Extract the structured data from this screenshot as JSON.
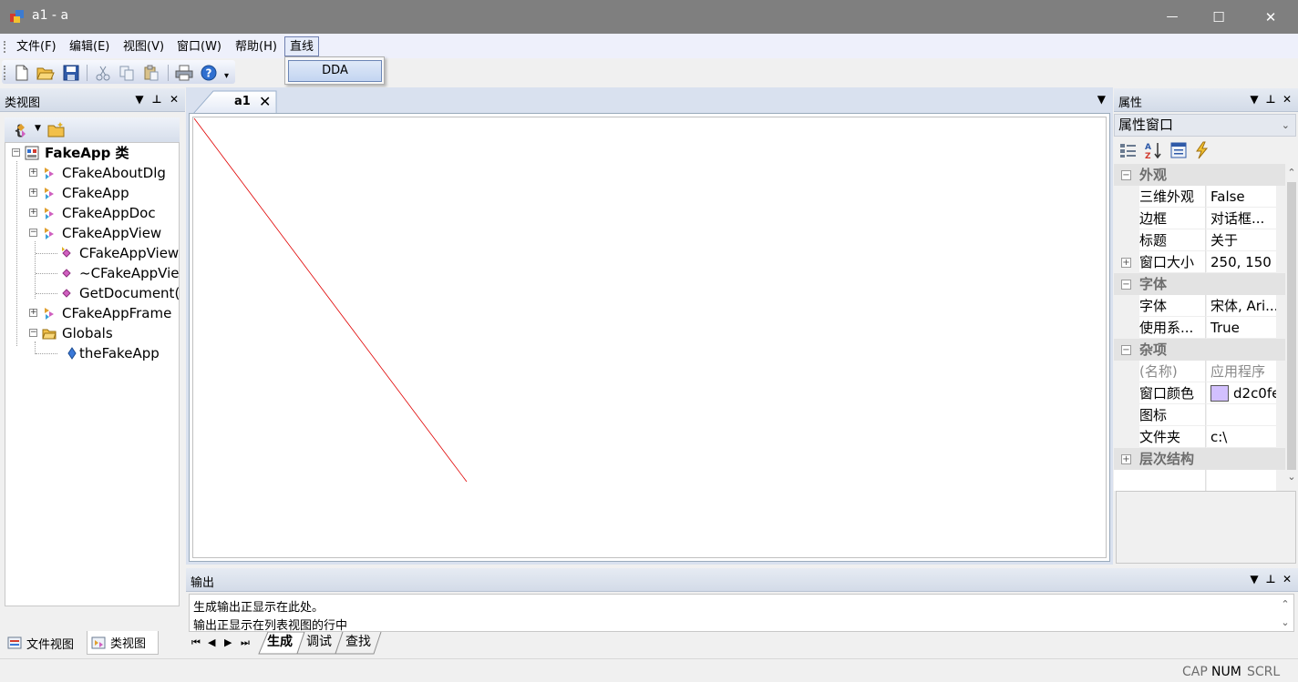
{
  "window": {
    "title": "a1 - a",
    "minimize_glyph": "—",
    "maximize_glyph": "☐",
    "close_glyph": "✕"
  },
  "menu": {
    "items": [
      "文件(F)",
      "编辑(E)",
      "视图(V)",
      "窗口(W)",
      "帮助(H)",
      "直线"
    ],
    "open_menu": {
      "label": "直线",
      "items": [
        "DDA"
      ]
    }
  },
  "toolbar": {
    "buttons": [
      "new-icon",
      "open-icon",
      "save-icon",
      "cut-icon",
      "copy-icon",
      "paste-icon",
      "print-icon",
      "help-icon"
    ],
    "overflow_glyph": "▾"
  },
  "class_view": {
    "title": "类视图",
    "header_buttons": {
      "dropdown": "▼",
      "pin": "⊥",
      "close": "✕"
    },
    "tree": [
      {
        "label": "FakeApp 类",
        "level": 0,
        "expander": "−",
        "icon": "class-root-icon",
        "bold": true
      },
      {
        "label": "CFakeAboutDlg",
        "level": 1,
        "expander": "+",
        "icon": "class-icon"
      },
      {
        "label": "CFakeApp",
        "level": 1,
        "expander": "+",
        "icon": "class-icon"
      },
      {
        "label": "CFakeAppDoc",
        "level": 1,
        "expander": "+",
        "icon": "class-icon"
      },
      {
        "label": "CFakeAppView",
        "level": 1,
        "expander": "−",
        "icon": "class-icon"
      },
      {
        "label": "CFakeAppView",
        "level": 2,
        "expander": "",
        "icon": "method-icon"
      },
      {
        "label": "~CFakeAppView",
        "level": 2,
        "expander": "",
        "icon": "method-icon"
      },
      {
        "label": "GetDocument()",
        "level": 2,
        "expander": "",
        "icon": "method-icon"
      },
      {
        "label": "CFakeAppFrame",
        "level": 1,
        "expander": "+",
        "icon": "class-icon"
      },
      {
        "label": "Globals",
        "level": 1,
        "expander": "−",
        "icon": "folder-icon"
      },
      {
        "label": "theFakeApp",
        "level": 2,
        "expander": "",
        "icon": "variable-icon"
      }
    ],
    "bottom_tabs": [
      {
        "label": "文件视图",
        "icon": "file-view-icon",
        "active": false
      },
      {
        "label": "类视图",
        "icon": "class-view-icon",
        "active": true
      }
    ]
  },
  "document": {
    "tab_label": "a1",
    "tab_close": "✕",
    "dropdown_glyph": "▼",
    "line_color": "#e00000"
  },
  "properties": {
    "title": "属性",
    "header_buttons": {
      "dropdown": "▼",
      "pin": "⊥",
      "close": "✕"
    },
    "combo_value": "属性窗口",
    "combo_chevron": "⌄",
    "toolbar": [
      "categorized-icon",
      "alphabetical-icon",
      "property-pages-icon",
      "events-icon"
    ],
    "rows": [
      {
        "type": "category",
        "name": "外观",
        "expander": "−"
      },
      {
        "type": "prop",
        "name": "三维外观",
        "value": "False"
      },
      {
        "type": "prop",
        "name": "边框",
        "value": "对话框..."
      },
      {
        "type": "prop",
        "name": "标题",
        "value": "关于"
      },
      {
        "type": "prop",
        "name": "窗口大小",
        "value": "250, 150",
        "expander": "+"
      },
      {
        "type": "category",
        "name": "字体",
        "expander": "−"
      },
      {
        "type": "prop",
        "name": "字体",
        "value": "宋体, Ari..."
      },
      {
        "type": "prop",
        "name": "使用系...",
        "value": "True"
      },
      {
        "type": "category",
        "name": "杂项",
        "expander": "−"
      },
      {
        "type": "prop",
        "name": "(名称)",
        "value": "应用程序",
        "gray": true
      },
      {
        "type": "prop",
        "name": "窗口颜色",
        "value": "d2c0fe",
        "swatch": "#d2c0fe"
      },
      {
        "type": "prop",
        "name": "图标",
        "value": ""
      },
      {
        "type": "prop",
        "name": "文件夹",
        "value": "c:\\"
      },
      {
        "type": "category",
        "name": "层次结构",
        "expander": "+"
      }
    ]
  },
  "output": {
    "title": "输出",
    "header_buttons": {
      "dropdown": "▼",
      "pin": "⊥",
      "close": "✕"
    },
    "lines": [
      "生成输出正显示在此处。",
      "输出正显示在列表视图的行中"
    ],
    "nav": [
      "⏮",
      "◀",
      "▶",
      "⏭"
    ],
    "tabs": [
      {
        "label": "生成",
        "active": true
      },
      {
        "label": "调试",
        "active": false
      },
      {
        "label": "查找",
        "active": false
      }
    ]
  },
  "statusbar": {
    "indicators": [
      {
        "label": "CAP",
        "on": false
      },
      {
        "label": "NUM",
        "on": true
      },
      {
        "label": "SCRL",
        "on": false
      }
    ]
  }
}
